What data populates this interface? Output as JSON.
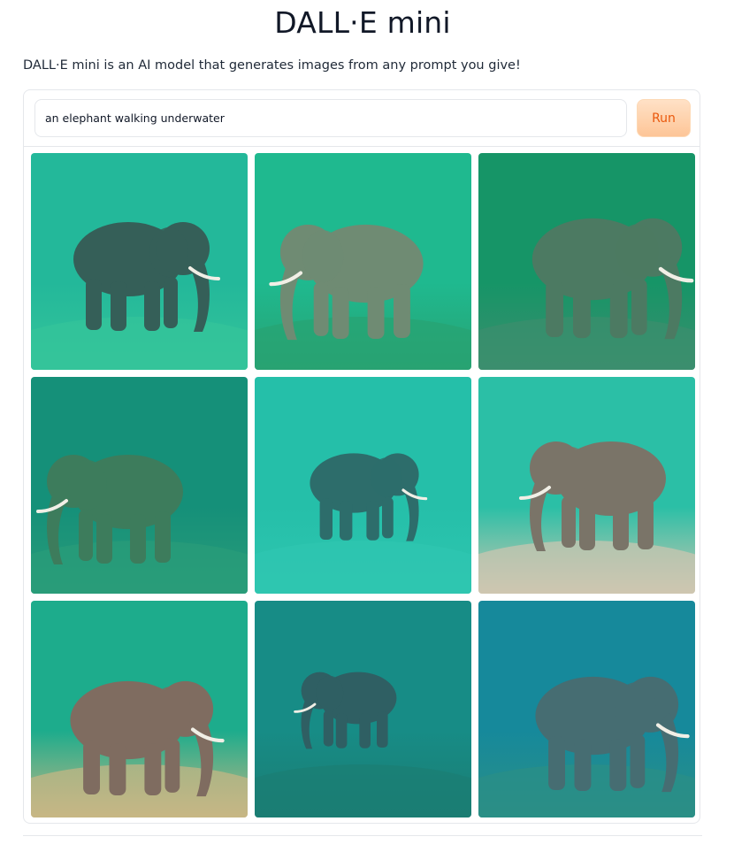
{
  "header": {
    "title": "DALL·E mini",
    "description": "DALL·E mini is an AI model that generates images from any prompt you give!"
  },
  "prompt": {
    "value": "an elephant walking underwater",
    "run_label": "Run"
  },
  "gallery": {
    "images": [
      {
        "subject": "elephant-underwater-1",
        "water": "#23b89a",
        "floor": "#35c49a",
        "body": "#355f58"
      },
      {
        "subject": "elephant-underwater-2",
        "water": "#1fb98f",
        "floor": "#28a272",
        "body": "#6f8b73"
      },
      {
        "subject": "elephant-underwater-3",
        "water": "#169567",
        "floor": "#3c8e6e",
        "body": "#4c7a62"
      },
      {
        "subject": "elephant-underwater-4",
        "water": "#159079",
        "floor": "#2a9c79",
        "body": "#3d7c5c"
      },
      {
        "subject": "elephant-underwater-5",
        "water": "#25bfa9",
        "floor": "#2fc6b0",
        "body": "#2d6d6b"
      },
      {
        "subject": "elephant-underwater-6",
        "water": "#2bbfa6",
        "floor": "#cfc6b0",
        "body": "#7a7468"
      },
      {
        "subject": "elephant-underwater-7",
        "water": "#1dac8c",
        "floor": "#c7b684",
        "body": "#7f6c60"
      },
      {
        "subject": "elephant-underwater-8",
        "water": "#178c86",
        "floor": "#1b7d73",
        "body": "#2f5f63"
      },
      {
        "subject": "elephant-underwater-9",
        "water": "#16899b",
        "floor": "#2b8f86",
        "body": "#466d72"
      }
    ]
  }
}
